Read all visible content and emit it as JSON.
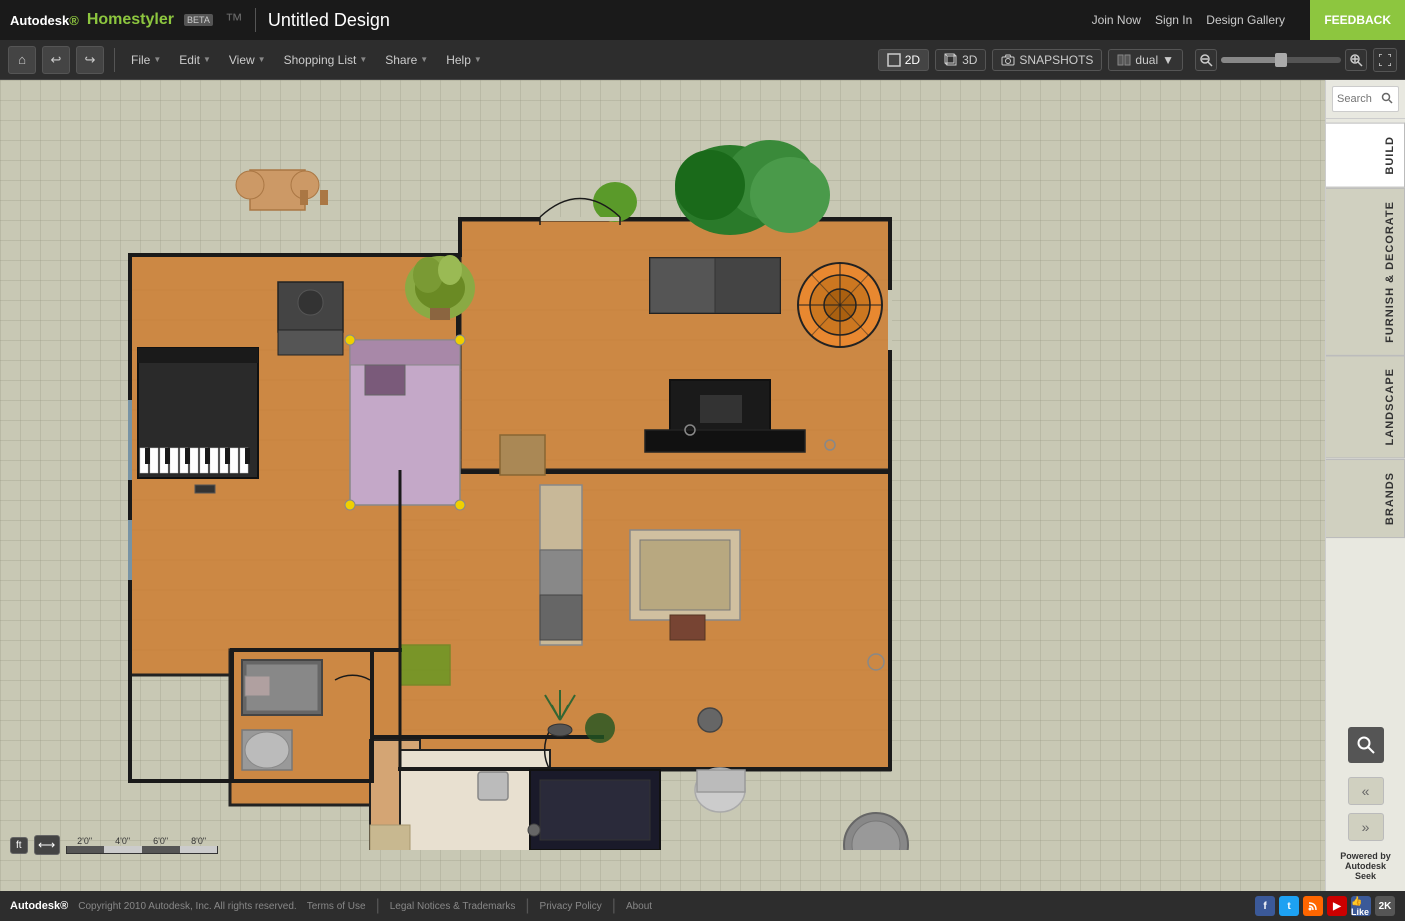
{
  "app": {
    "name": "Autodesk",
    "product": "Homestyler",
    "beta": "BETA",
    "tm": "™",
    "title": "Untitled Design"
  },
  "nav": {
    "join_now": "Join Now",
    "sign_in": "Sign In",
    "design_gallery": "Design Gallery",
    "feedback": "FEEDBACK"
  },
  "toolbar": {
    "file": "File",
    "edit": "Edit",
    "view": "View",
    "shopping_list": "Shopping List",
    "share": "Share",
    "help": "Help",
    "btn_2d": "2D",
    "btn_3d": "3D",
    "snapshots": "SNAPSHOTS",
    "dual": "dual"
  },
  "sidebar": {
    "tabs": [
      "BUILD",
      "FURNISH & DECORATE",
      "LANDSCAPE",
      "BRANDS"
    ],
    "search_placeholder": "Search"
  },
  "footer": {
    "autodesk": "Autodesk®",
    "copyright": "Copyright 2010 Autodesk, Inc. All rights reserved.",
    "terms": "Terms of Use",
    "legal": "Legal Notices & Trademarks",
    "privacy": "Privacy Policy",
    "about": "About",
    "powered_by": "Powered by Autodesk Seek"
  },
  "scale": {
    "unit": "ft",
    "marks": [
      "2'0\"",
      "4'0\"",
      "6'0\"",
      "8'0\""
    ]
  },
  "colors": {
    "floor_wood": "#cc8844",
    "wall": "#2a2a2a",
    "accent_green": "#8dc63f",
    "bg_dark": "#1a1a1a",
    "toolbar_bg": "#2d2d2d"
  }
}
